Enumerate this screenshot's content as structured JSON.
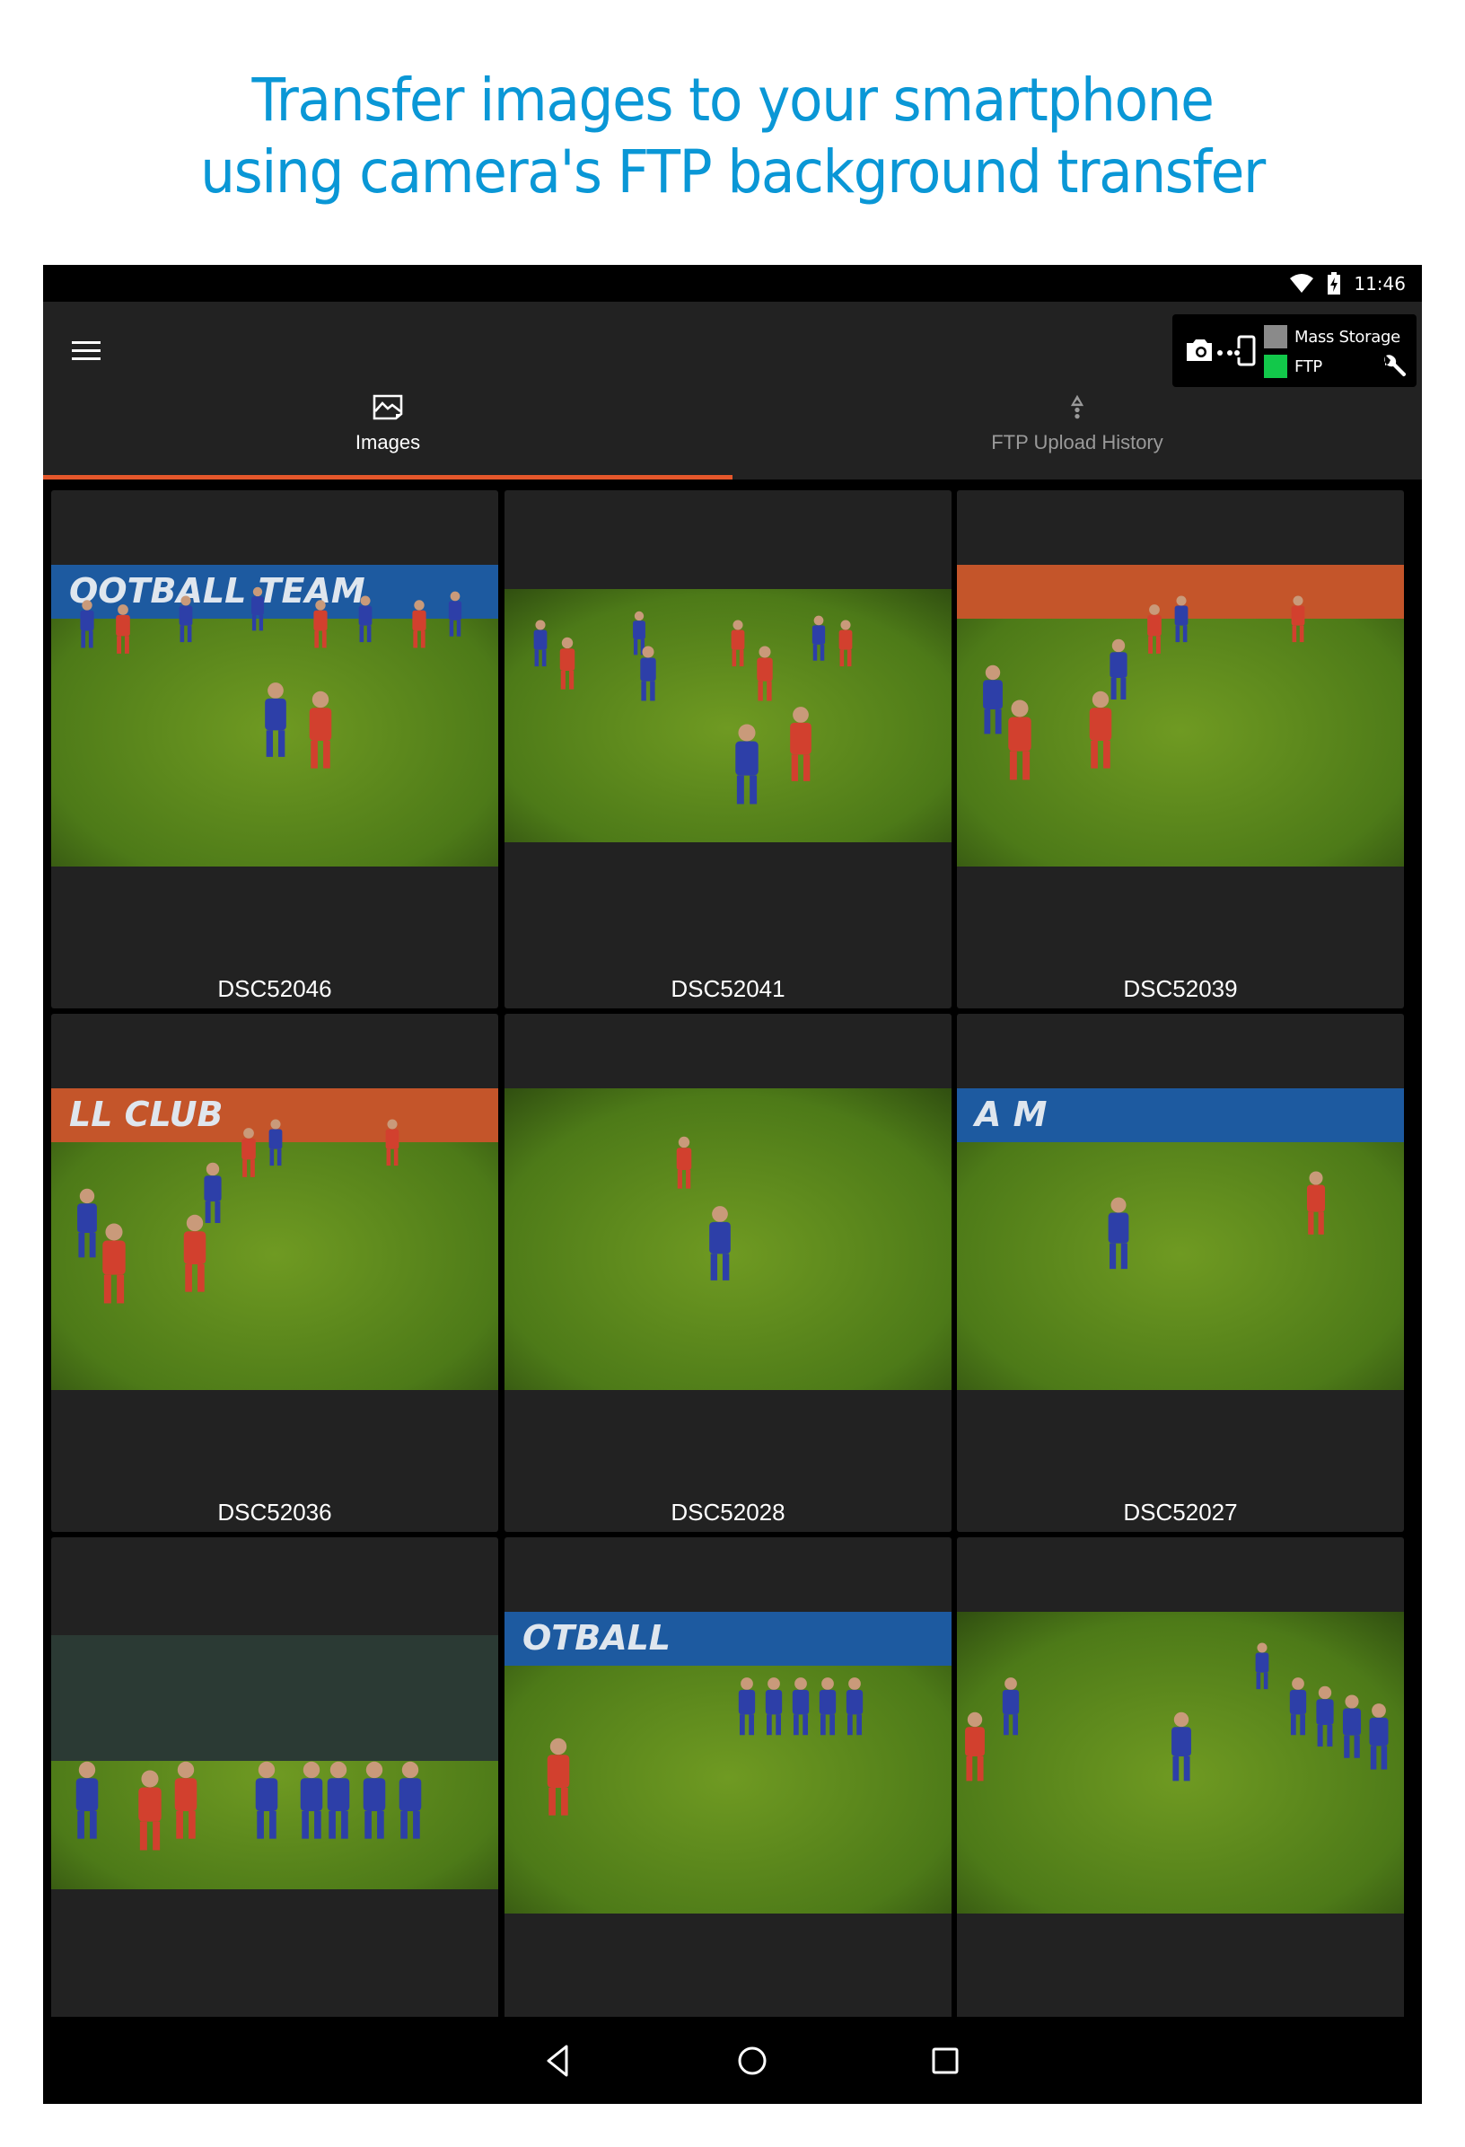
{
  "headline": {
    "line1": "Transfer images to your smartphone",
    "line2": "using camera's FTP background transfer",
    "color": "#0a97d6"
  },
  "status_bar": {
    "time": "11:46",
    "icons": [
      "wifi-icon",
      "battery-charging-icon"
    ]
  },
  "app_bar": {
    "menu_icon": "hamburger-menu-icon",
    "mode_panel": {
      "connection_icon": "camera-to-phone-icon",
      "modes": [
        {
          "label": "Mass Storage",
          "active": false,
          "color": "#8a8a8a"
        },
        {
          "label": "FTP",
          "active": true,
          "color": "#12c84a"
        }
      ],
      "settings_icon": "wrench-icon"
    },
    "tabs": [
      {
        "label": "Images",
        "icon": "image-icon",
        "active": true
      },
      {
        "label": "FTP Upload History",
        "icon": "upload-icon",
        "active": false
      }
    ],
    "accent_color": "#e5572b"
  },
  "images": [
    {
      "name": "DSC52046",
      "scene": "wide-play",
      "banner": "OOTBALL TEAM"
    },
    {
      "name": "DSC52041",
      "scene": "wide-field",
      "banner": ""
    },
    {
      "name": "DSC52039",
      "scene": "header-duel",
      "banner": ""
    },
    {
      "name": "DSC52036",
      "scene": "header-duel",
      "banner": "LL CLUB"
    },
    {
      "name": "DSC52028",
      "scene": "tackle",
      "banner": ""
    },
    {
      "name": "DSC52027",
      "scene": "bicycle-kick",
      "banner": "A M"
    },
    {
      "name": "",
      "scene": "free-kick",
      "banner": ""
    },
    {
      "name": "",
      "scene": "wall",
      "banner": "OTBALL"
    },
    {
      "name": "",
      "scene": "celebration",
      "banner": ""
    }
  ],
  "nav_bar": {
    "buttons": [
      "back-icon",
      "home-icon",
      "recents-icon"
    ]
  }
}
